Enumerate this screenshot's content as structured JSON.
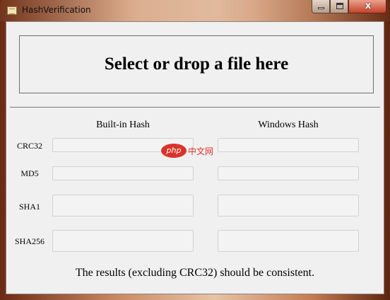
{
  "window": {
    "title": "HashVerification",
    "icon": "app-icon",
    "controls": {
      "minimize": "minimize-icon",
      "maximize": "maximize-icon",
      "close_label": "x"
    }
  },
  "drop_zone": {
    "label": "Select or drop a file here"
  },
  "columns": {
    "builtin": "Built-in Hash",
    "windows": "Windows Hash"
  },
  "rows": [
    {
      "label": "CRC32",
      "builtin_value": "",
      "windows_value": ""
    },
    {
      "label": "MD5",
      "builtin_value": "",
      "windows_value": ""
    },
    {
      "label": "SHA1",
      "builtin_value": "",
      "windows_value": ""
    },
    {
      "label": "SHA256",
      "builtin_value": "",
      "windows_value": ""
    }
  ],
  "footer": {
    "note": "The results (excluding CRC32) should be consistent."
  },
  "watermark": {
    "logo": "php",
    "text": "中文网"
  },
  "colors": {
    "client_bg": "#f0f0f0",
    "close_button": "#c4432a",
    "watermark": "#d9342b"
  }
}
